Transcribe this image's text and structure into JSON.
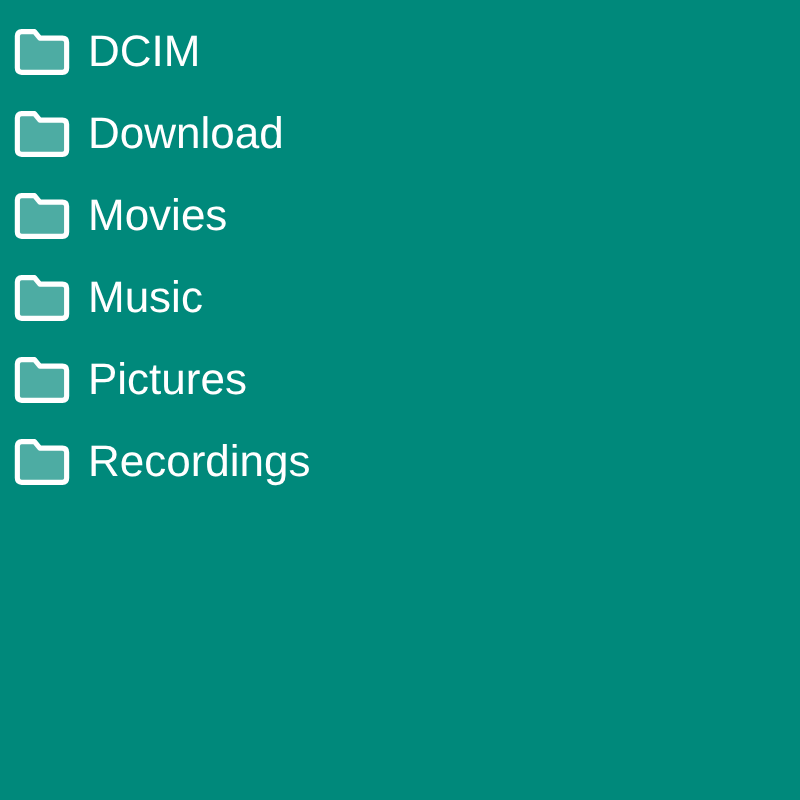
{
  "folders": [
    {
      "name": "DCIM"
    },
    {
      "name": "Download"
    },
    {
      "name": "Movies"
    },
    {
      "name": "Music"
    },
    {
      "name": "Pictures"
    },
    {
      "name": "Recordings"
    }
  ]
}
